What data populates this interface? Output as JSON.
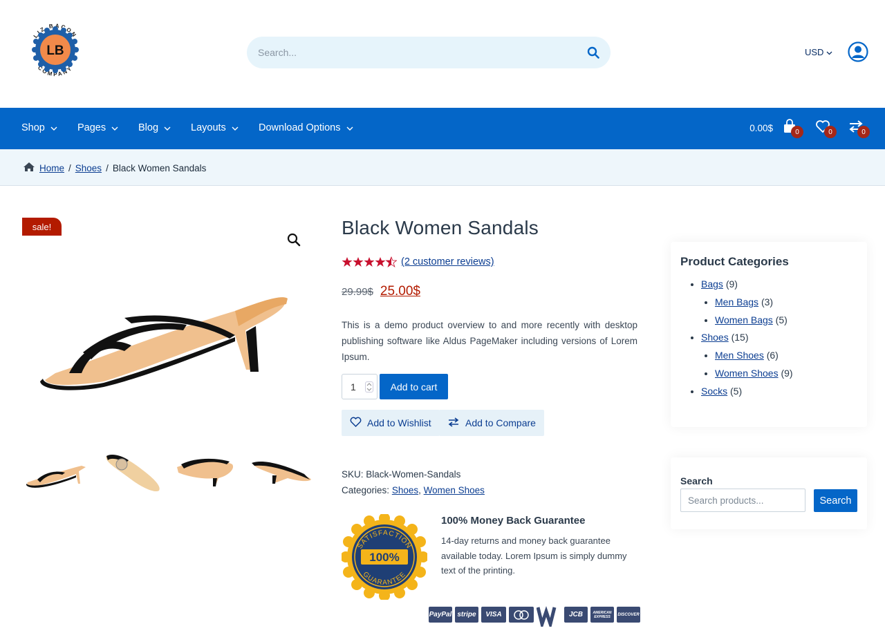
{
  "header": {
    "logo": {
      "top_text": "LIZ BACON",
      "bottom_text": "COMPANY",
      "initials": "LB"
    },
    "search": {
      "placeholder": "Search..."
    },
    "currency": "USD"
  },
  "nav": {
    "items": [
      "Shop",
      "Pages",
      "Blog",
      "Layouts",
      "Download Options"
    ],
    "cart_total": "0.00$",
    "cart_count": "0",
    "wishlist_count": "0",
    "compare_count": "0"
  },
  "breadcrumb": {
    "home": "Home",
    "sep": "/",
    "category": "Shoes",
    "current": "Black Women Sandals"
  },
  "product": {
    "sale_badge": "sale!",
    "title": "Black Women Sandals",
    "rating": 4.5,
    "reviews_link": "(2 customer reviews)",
    "old_price": "29.99$",
    "new_price": "25.00$",
    "description": "This is a demo product overview to and more recently with desktop publishing software like Aldus PageMaker including versions of Lorem Ipsum.",
    "quantity": "1",
    "add_to_cart": "Add to cart",
    "wishlist": "Add to Wishlist",
    "compare": "Add to Compare",
    "sku_label": "SKU:",
    "sku": "Black-Women-Sandals",
    "categories_label": "Categories:",
    "categories": [
      "Shoes",
      "Women Shoes"
    ],
    "category_sep": ","
  },
  "guarantee": {
    "seal_top": "SATISFACTION",
    "seal_value": "100%",
    "seal_bottom": "GUARANTEE",
    "title": "100% Money Back Guarantee",
    "text": "14-day returns and money back guarantee available today. Lorem Ipsum is simply dummy text of the printing."
  },
  "payments": [
    "PayPal",
    "stripe",
    "VISA",
    "",
    "",
    "JCB",
    "AMERICAN EXPRESS",
    "DISCOVER"
  ],
  "sidebar": {
    "categories_title": "Product Categories",
    "categories": [
      {
        "name": "Bags",
        "count": "(9)",
        "children": [
          {
            "name": "Men Bags",
            "count": "(3)"
          },
          {
            "name": "Women Bags",
            "count": "(5)"
          }
        ]
      },
      {
        "name": "Shoes",
        "count": "(15)",
        "children": [
          {
            "name": "Men Shoes",
            "count": "(6)"
          },
          {
            "name": "Women Shoes",
            "count": "(9)"
          }
        ]
      },
      {
        "name": "Socks",
        "count": "(5)",
        "children": []
      }
    ],
    "search_label": "Search",
    "search_placeholder": "Search products...",
    "search_button": "Search"
  },
  "colors": {
    "primary": "#0466c8",
    "sale": "#b31b00",
    "star": "#c8102e",
    "badge": "#a52718"
  }
}
